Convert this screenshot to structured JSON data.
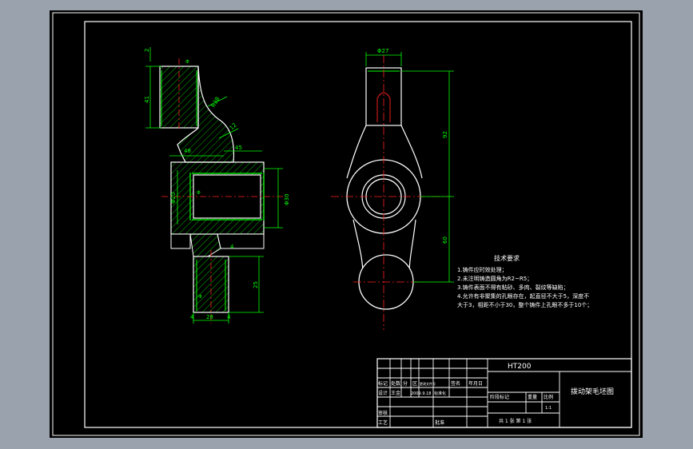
{
  "colors": {
    "background": "#000000",
    "frame": "#ffffff",
    "outline": "#ffffff",
    "hatch": "#00c800",
    "dimension": "#00ff00",
    "centerline": "#ff2020",
    "notes": "#ffffff",
    "surround": "#9aa3ad"
  },
  "icons": [
    "cad-drawing-sheet"
  ],
  "side_view": {
    "dims_vertical": [
      "2",
      "41",
      "Φ20",
      "Φ30",
      "25"
    ],
    "dims_angled": [
      "R38",
      "12"
    ],
    "dims_horizontal": [
      "48",
      "45",
      "28",
      "4",
      "4",
      "4"
    ],
    "small_labels": [
      "Φ",
      "Φ",
      "Φ"
    ]
  },
  "front_view": {
    "dims": [
      "Φ27",
      "92",
      "60"
    ]
  },
  "tech_notes": {
    "title": "技术要求",
    "lines": [
      "1.铸件应时效处理；",
      "2.未注明铸造圆角为R2~R5；",
      "3.铸件表面不得有粘砂、多肉、裂纹等缺陷；",
      "4.允许有非聚集的孔眼存在，起直径不大于5，深度不",
      "  大于3，相距不小于30，整个铸件上孔眼不多于10个；"
    ]
  },
  "title_block": {
    "material": "HT200",
    "drawing_name": "拨动架毛坯图",
    "scale": "1:1",
    "rev_labels": [
      "标记",
      "处数",
      "分",
      "区",
      "更改文件号",
      "签名",
      "年月日"
    ],
    "row2_labels": [
      "设计",
      "王金",
      "2009.9.18",
      "标准化"
    ],
    "row3_label": "审核",
    "row4_label": "工艺",
    "approve_label": "批准",
    "stage_labels": [
      "阶段标记",
      "重量",
      "比例"
    ],
    "sheet_label": "共 1 张  第 1 张"
  }
}
